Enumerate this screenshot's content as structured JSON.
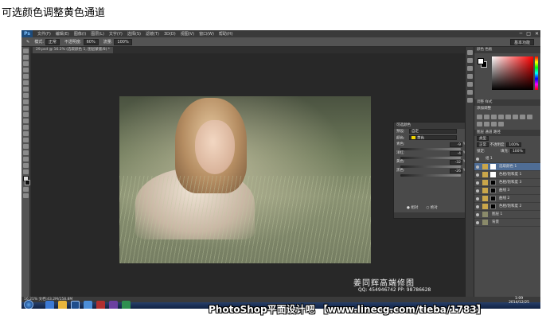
{
  "caption": "可选颜色调整黄色通道",
  "app": {
    "logo": "Ps",
    "menu": [
      "文件(F)",
      "编辑(E)",
      "图像(I)",
      "图层(L)",
      "文字(Y)",
      "选择(S)",
      "滤镜(T)",
      "3D(D)",
      "视图(V)",
      "窗口(W)",
      "帮助(H)"
    ],
    "window_buttons": [
      "─",
      "□",
      "✕"
    ]
  },
  "options_bar": {
    "mode_label": "模式:",
    "mode_value": "正常",
    "opacity_label": "不透明度:",
    "opacity_value": "60%",
    "flow_label": "流量:",
    "flow_value": "100%",
    "workspace": "基本功能"
  },
  "document_tab": "29.psd @ 16.2% (选取颜色 1, 图层蒙版/8) *",
  "properties": {
    "title": "可选颜色",
    "preset_label": "预设:",
    "preset_value": "自定",
    "colors_label": "颜色:",
    "colors_value": "黄色",
    "sliders": [
      {
        "label": "青色:",
        "value": "-9",
        "unit": "%"
      },
      {
        "label": "洋红:",
        "value": "-4",
        "unit": "%"
      },
      {
        "label": "黄色:",
        "value": "-32",
        "unit": "%"
      },
      {
        "label": "黑色:",
        "value": "-26",
        "unit": "%"
      }
    ],
    "radio_relative": "相对",
    "radio_absolute": "绝对"
  },
  "right_panel": {
    "tabs": "颜色  色板",
    "adjust_tabs": "调整  样式",
    "adjust_title": "添加调整",
    "layers_tabs": "图层  通道  路径",
    "kind_label": "类型",
    "blend_mode": "正常",
    "opacity_label": "不透明度:",
    "opacity_value": "100%",
    "lock_label": "锁定:",
    "fill_label": "填充:",
    "fill_value": "100%",
    "layers": [
      {
        "name": "组 1",
        "kind": "group"
      },
      {
        "name": "选取颜色 1",
        "kind": "adjustment",
        "mask": "white",
        "active": true
      },
      {
        "name": "色相/饱和度 1",
        "kind": "adjustment",
        "mask": "white"
      },
      {
        "name": "色相/饱和度 3",
        "kind": "adjustment",
        "mask": "black"
      },
      {
        "name": "曲线 3",
        "kind": "adjustment",
        "mask": "black"
      },
      {
        "name": "曲线 2",
        "kind": "adjustment",
        "mask": "black"
      },
      {
        "name": "色相/饱和度 2",
        "kind": "adjustment",
        "mask": "black"
      },
      {
        "name": "图层 1",
        "kind": "pixel"
      },
      {
        "name": "背景",
        "kind": "background"
      }
    ]
  },
  "status_bar": "16.21%   文档:43.2M/158.8M",
  "taskbar": {
    "clock_time": "1:09",
    "clock_date": "2014/12/25"
  },
  "watermark": {
    "author": "姜同辉高端修图",
    "contact": "QQ: 454946742   PP: 98786628",
    "banner": "PhotoShop平面设计吧  【www.linecg.com/tieba/1783】"
  },
  "colors": {
    "accent": "#4f6d95",
    "ui_dark": "#343434",
    "panel": "#4a4a4a",
    "yellow": "#f0d400"
  }
}
